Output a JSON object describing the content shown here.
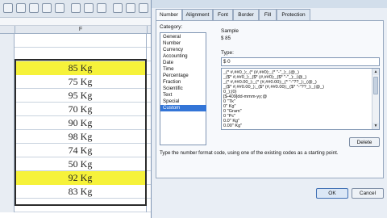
{
  "sheet": {
    "column_letter": "F",
    "cells": [
      {
        "value": "85 Kg",
        "highlight": true
      },
      {
        "value": "75 Kg",
        "highlight": false
      },
      {
        "value": "95 Kg",
        "highlight": false
      },
      {
        "value": "70 Kg",
        "highlight": false
      },
      {
        "value": "90 Kg",
        "highlight": false
      },
      {
        "value": "98 Kg",
        "highlight": false
      },
      {
        "value": "74 Kg",
        "highlight": false
      },
      {
        "value": "50 Kg",
        "highlight": false
      },
      {
        "value": "92 Kg",
        "highlight": true
      },
      {
        "value": "83 Kg",
        "highlight": false
      }
    ],
    "highlight_color": "#f6f23a"
  },
  "dialog": {
    "tabs": [
      "Number",
      "Alignment",
      "Font",
      "Border",
      "Fill",
      "Protection"
    ],
    "category_label": "Category:",
    "categories": [
      "General",
      "Number",
      "Currency",
      "Accounting",
      "Date",
      "Time",
      "Percentage",
      "Fraction",
      "Scientific",
      "Text",
      "Special",
      "Custom"
    ],
    "selected_category": "Custom",
    "sample_label": "Sample",
    "sample_value": "$ 85",
    "type_label": "Type:",
    "type_value": "$ 0",
    "format_codes": [
      "_(* #,##0_);_(* (#,##0);_(* \"-\"_);_(@_)",
      "_($* #,##0_);_($* (#,##0);_($* \"-\"_);_(@_)",
      "_(* #,##0.00_);_(* (#,##0.00);_(* \"-\"??_);_(@_)",
      "_($* #,##0.00_);_($* (#,##0.00);_($* \"-\"??_);_(@_)",
      "0_);(0)",
      "[$-409]dd-mmm-yy;@",
      "0 \"Tk\"",
      "0\" Kg\"",
      "0 \"Gram\"",
      "0 \"Pc\"",
      "0.0\" Kg\"",
      "0.00\" Kg\""
    ],
    "delete_label": "Delete",
    "description": "Type the number format code, using one of the existing codes as a starting point.",
    "ok_label": "OK",
    "cancel_label": "Cancel",
    "accent_color": "#3375d7"
  }
}
